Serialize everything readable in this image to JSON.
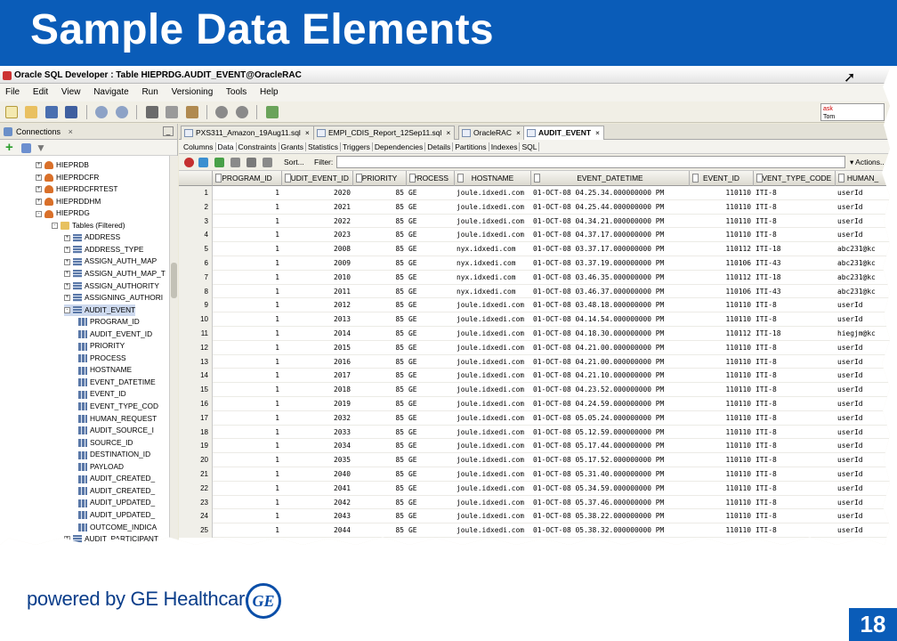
{
  "slide": {
    "title": "Sample Data Elements",
    "footer": "powered by GE Healthcare",
    "logo_text": "GE",
    "page_number": "18",
    "colors": {
      "banner": "#0a5cb8",
      "footer_text": "#0a3d8a"
    }
  },
  "window": {
    "title": "Oracle SQL Developer : Table HIEPRDG.AUDIT_EVENT@OracleRAC",
    "menu": [
      "File",
      "Edit",
      "View",
      "Navigate",
      "Run",
      "Versioning",
      "Tools",
      "Help"
    ],
    "ask_box": {
      "line1": "ask",
      "line2": "Tom"
    }
  },
  "connections": {
    "tab_label": "Connections",
    "tab_close": "×",
    "minimize": "_",
    "tree": [
      {
        "label": "HIEPRDB",
        "type": "db",
        "expand": "+"
      },
      {
        "label": "HIEPRDCFR",
        "type": "db",
        "expand": "+"
      },
      {
        "label": "HIEPRDCFRTEST",
        "type": "db",
        "expand": "+"
      },
      {
        "label": "HIEPRDDHM",
        "type": "db",
        "expand": "+"
      },
      {
        "label": "HIEPRDG",
        "type": "db",
        "expand": "-"
      },
      {
        "label": "Tables (Filtered)",
        "type": "folder",
        "expand": "-"
      },
      {
        "label": "ADDRESS",
        "type": "table",
        "expand": "+"
      },
      {
        "label": "ADDRESS_TYPE",
        "type": "table",
        "expand": "+"
      },
      {
        "label": "ASSIGN_AUTH_MAP",
        "type": "table",
        "expand": "+"
      },
      {
        "label": "ASSIGN_AUTH_MAP_T",
        "type": "table",
        "expand": "+"
      },
      {
        "label": "ASSIGN_AUTHORITY",
        "type": "table",
        "expand": "+"
      },
      {
        "label": "ASSIGNING_AUTHORI",
        "type": "table",
        "expand": "+"
      },
      {
        "label": "AUDIT_EVENT",
        "type": "table",
        "expand": "-",
        "selected": true
      },
      {
        "label": "PROGRAM_ID",
        "type": "column"
      },
      {
        "label": "AUDIT_EVENT_ID",
        "type": "column"
      },
      {
        "label": "PRIORITY",
        "type": "column"
      },
      {
        "label": "PROCESS",
        "type": "column"
      },
      {
        "label": "HOSTNAME",
        "type": "column"
      },
      {
        "label": "EVENT_DATETIME",
        "type": "column"
      },
      {
        "label": "EVENT_ID",
        "type": "column"
      },
      {
        "label": "EVENT_TYPE_COD",
        "type": "column"
      },
      {
        "label": "HUMAN_REQUEST",
        "type": "column"
      },
      {
        "label": "AUDIT_SOURCE_I",
        "type": "column"
      },
      {
        "label": "SOURCE_ID",
        "type": "column"
      },
      {
        "label": "DESTINATION_ID",
        "type": "column"
      },
      {
        "label": "PAYLOAD",
        "type": "column"
      },
      {
        "label": "AUDIT_CREATED_",
        "type": "column"
      },
      {
        "label": "AUDIT_CREATED_",
        "type": "column"
      },
      {
        "label": "AUDIT_UPDATED_",
        "type": "column"
      },
      {
        "label": "AUDIT_UPDATED_",
        "type": "column"
      },
      {
        "label": "OUTCOME_INDICA",
        "type": "column"
      },
      {
        "label": "AUDIT_PARTICIPANT",
        "type": "table",
        "expand": "+"
      }
    ]
  },
  "doc_tabs": [
    {
      "label": "PXS311_Amazon_19Aug11.sql",
      "close": "×"
    },
    {
      "label": "EMPI_CDIS_Report_12Sep11.sql",
      "close": "×"
    },
    {
      "label": "OracleRAC",
      "close": "×"
    },
    {
      "label": "AUDIT_EVENT",
      "close": "×",
      "active": true
    }
  ],
  "sub_tabs": [
    "Columns",
    "Data",
    "Constraints",
    "Grants",
    "Statistics",
    "Triggers",
    "Dependencies",
    "Details",
    "Partitions",
    "Indexes",
    "SQL"
  ],
  "grid_toolbar": {
    "sort": "Sort...",
    "filter": "Filter:",
    "filter_value": "",
    "actions": "▾ Actions..."
  },
  "grid": {
    "columns": [
      "PROGRAM_ID",
      "AUDIT_EVENT_ID",
      "PRIORITY",
      "PROCESS",
      "HOSTNAME",
      "EVENT_DATETIME",
      "EVENT_ID",
      "EVENT_TYPE_CODE",
      "HUMAN_"
    ],
    "rows": [
      [
        "1",
        "1",
        "2020",
        "85",
        "GE",
        "joule.idxedi.com",
        "01-OCT-08 04.25.34.000000000 PM",
        "110110",
        "ITI-8",
        "userId"
      ],
      [
        "2",
        "1",
        "2021",
        "85",
        "GE",
        "joule.idxedi.com",
        "01-OCT-08 04.25.44.000000000 PM",
        "110110",
        "ITI-8",
        "userId"
      ],
      [
        "3",
        "1",
        "2022",
        "85",
        "GE",
        "joule.idxedi.com",
        "01-OCT-08 04.34.21.000000000 PM",
        "110110",
        "ITI-8",
        "userId"
      ],
      [
        "4",
        "1",
        "2023",
        "85",
        "GE",
        "joule.idxedi.com",
        "01-OCT-08 04.37.17.000000000 PM",
        "110110",
        "ITI-8",
        "userId"
      ],
      [
        "5",
        "1",
        "2008",
        "85",
        "GE",
        "nyx.idxedi.com",
        "01-OCT-08 03.37.17.000000000 PM",
        "110112",
        "ITI-18",
        "abc231@kc"
      ],
      [
        "6",
        "1",
        "2009",
        "85",
        "GE",
        "nyx.idxedi.com",
        "01-OCT-08 03.37.19.000000000 PM",
        "110106",
        "ITI-43",
        "abc231@kc"
      ],
      [
        "7",
        "1",
        "2010",
        "85",
        "GE",
        "nyx.idxedi.com",
        "01-OCT-08 03.46.35.000000000 PM",
        "110112",
        "ITI-18",
        "abc231@kc"
      ],
      [
        "8",
        "1",
        "2011",
        "85",
        "GE",
        "nyx.idxedi.com",
        "01-OCT-08 03.46.37.000000000 PM",
        "110106",
        "ITI-43",
        "abc231@kc"
      ],
      [
        "9",
        "1",
        "2012",
        "85",
        "GE",
        "joule.idxedi.com",
        "01-OCT-08 03.48.18.000000000 PM",
        "110110",
        "ITI-8",
        "userId"
      ],
      [
        "10",
        "1",
        "2013",
        "85",
        "GE",
        "joule.idxedi.com",
        "01-OCT-08 04.14.54.000000000 PM",
        "110110",
        "ITI-8",
        "userId"
      ],
      [
        "11",
        "1",
        "2014",
        "85",
        "GE",
        "joule.idxedi.com",
        "01-OCT-08 04.18.30.000000000 PM",
        "110112",
        "ITI-18",
        "hiegjm@kc"
      ],
      [
        "12",
        "1",
        "2015",
        "85",
        "GE",
        "joule.idxedi.com",
        "01-OCT-08 04.21.00.000000000 PM",
        "110110",
        "ITI-8",
        "userId"
      ],
      [
        "13",
        "1",
        "2016",
        "85",
        "GE",
        "joule.idxedi.com",
        "01-OCT-08 04.21.00.000000000 PM",
        "110110",
        "ITI-8",
        "userId"
      ],
      [
        "14",
        "1",
        "2017",
        "85",
        "GE",
        "joule.idxedi.com",
        "01-OCT-08 04.21.10.000000000 PM",
        "110110",
        "ITI-8",
        "userId"
      ],
      [
        "15",
        "1",
        "2018",
        "85",
        "GE",
        "joule.idxedi.com",
        "01-OCT-08 04.23.52.000000000 PM",
        "110110",
        "ITI-8",
        "userId"
      ],
      [
        "16",
        "1",
        "2019",
        "85",
        "GE",
        "joule.idxedi.com",
        "01-OCT-08 04.24.59.000000000 PM",
        "110110",
        "ITI-8",
        "userId"
      ],
      [
        "17",
        "1",
        "2032",
        "85",
        "GE",
        "joule.idxedi.com",
        "01-OCT-08 05.05.24.000000000 PM",
        "110110",
        "ITI-8",
        "userId"
      ],
      [
        "18",
        "1",
        "2033",
        "85",
        "GE",
        "joule.idxedi.com",
        "01-OCT-08 05.12.59.000000000 PM",
        "110110",
        "ITI-8",
        "userId"
      ],
      [
        "19",
        "1",
        "2034",
        "85",
        "GE",
        "joule.idxedi.com",
        "01-OCT-08 05.17.44.000000000 PM",
        "110110",
        "ITI-8",
        "userId"
      ],
      [
        "20",
        "1",
        "2035",
        "85",
        "GE",
        "joule.idxedi.com",
        "01-OCT-08 05.17.52.000000000 PM",
        "110110",
        "ITI-8",
        "userId"
      ],
      [
        "21",
        "1",
        "2040",
        "85",
        "GE",
        "joule.idxedi.com",
        "01-OCT-08 05.31.40.000000000 PM",
        "110110",
        "ITI-8",
        "userId"
      ],
      [
        "22",
        "1",
        "2041",
        "85",
        "GE",
        "joule.idxedi.com",
        "01-OCT-08 05.34.59.000000000 PM",
        "110110",
        "ITI-8",
        "userId"
      ],
      [
        "23",
        "1",
        "2042",
        "85",
        "GE",
        "joule.idxedi.com",
        "01-OCT-08 05.37.46.000000000 PM",
        "110110",
        "ITI-8",
        "userId"
      ],
      [
        "24",
        "1",
        "2043",
        "85",
        "GE",
        "joule.idxedi.com",
        "01-OCT-08 05.38.22.000000000 PM",
        "110110",
        "ITI-8",
        "userId"
      ],
      [
        "25",
        "1",
        "2044",
        "85",
        "GE",
        "joule.idxedi.com",
        "01-OCT-08 05.38.32.000000000 PM",
        "110110",
        "ITI-8",
        "userId"
      ]
    ]
  }
}
